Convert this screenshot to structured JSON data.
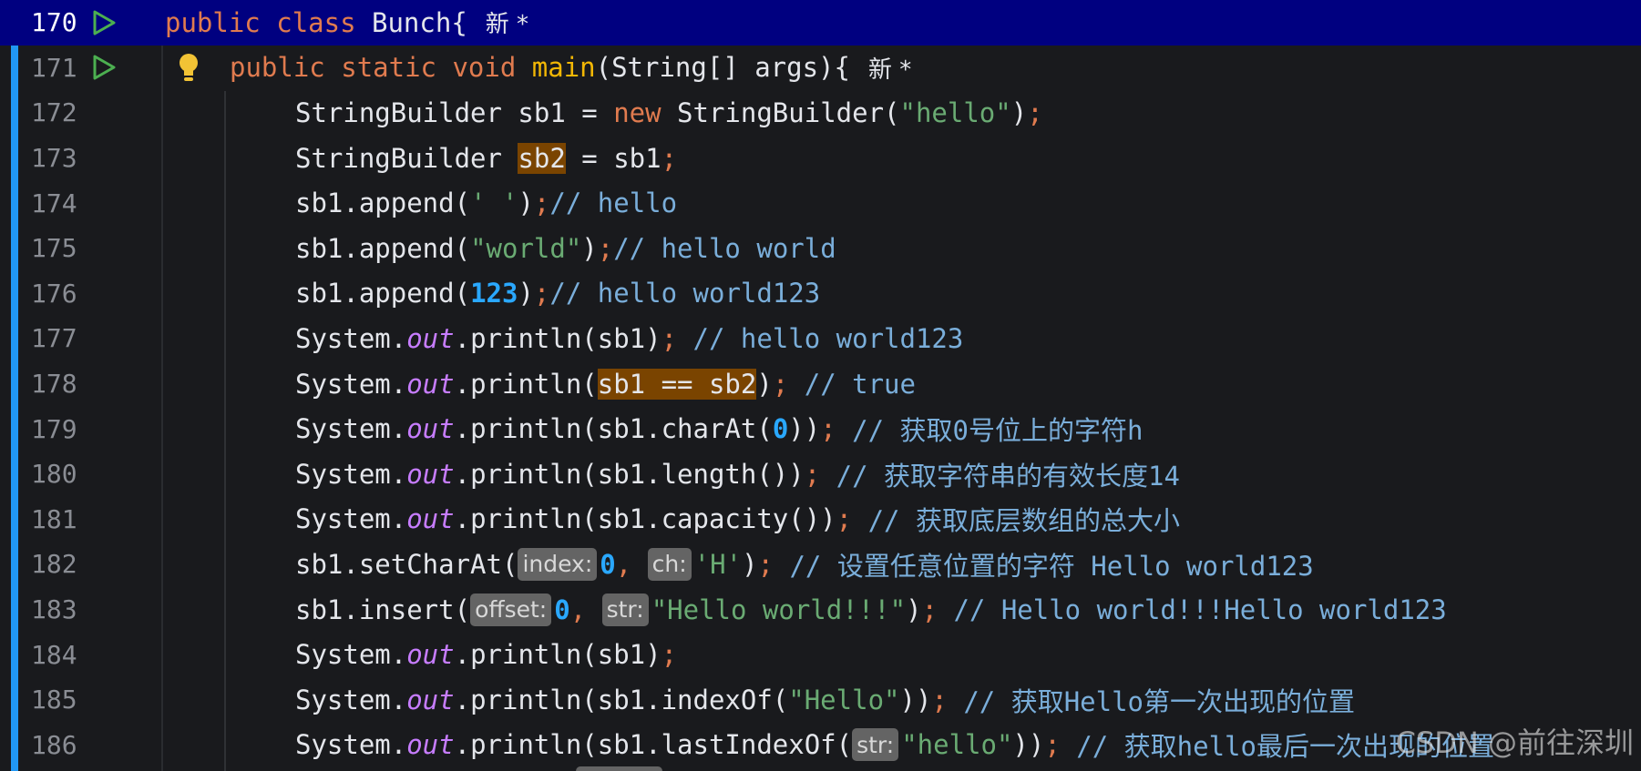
{
  "editor": {
    "language": "Java",
    "watermark": "CSDN @前往深圳",
    "new_mark": "新 *",
    "lines": [
      {
        "number": "170"
      },
      {
        "number": "171"
      },
      {
        "number": "172"
      },
      {
        "number": "173"
      },
      {
        "number": "174"
      },
      {
        "number": "175"
      },
      {
        "number": "176"
      },
      {
        "number": "177"
      },
      {
        "number": "178"
      },
      {
        "number": "179"
      },
      {
        "number": "180"
      },
      {
        "number": "181"
      },
      {
        "number": "182"
      },
      {
        "number": "183"
      },
      {
        "number": "184"
      },
      {
        "number": "185"
      },
      {
        "number": "186"
      }
    ],
    "code": {
      "l170": {
        "kw1": "public",
        "kw2": "class",
        "name": "Bunch{"
      },
      "l171": {
        "kw1": "public",
        "kw2": "static",
        "kw3": "void",
        "fn": "main",
        "rest": "(String[] args){"
      },
      "l172": {
        "a": "StringBuilder sb1 = ",
        "kw": "new",
        "b": " StringBuilder(",
        "str": "\"hello\"",
        "c": ")",
        "semi": ";"
      },
      "l173": {
        "a": "StringBuilder ",
        "hl": "sb2",
        "b": " = sb1",
        "semi": ";"
      },
      "l174": {
        "a": "sb1.append(",
        "str": "' '",
        "b": ")",
        "semi": ";",
        "comment": "// hello"
      },
      "l175": {
        "a": "sb1.append(",
        "str": "\"world\"",
        "b": ")",
        "semi": ";",
        "comment": "// hello world"
      },
      "l176": {
        "a": "sb1.append(",
        "num": "123",
        "b": ")",
        "semi": ";",
        "comment": "// hello world123"
      },
      "l177": {
        "a": "System.",
        "out": "out",
        "b": ".println(sb1)",
        "semi": ";",
        "comment": " // hello world123"
      },
      "l178": {
        "a": "System.",
        "out": "out",
        "b": ".println(",
        "hl": "sb1 == sb2",
        "c": ")",
        "semi": ";",
        "comment": " // true"
      },
      "l179": {
        "a": "System.",
        "out": "out",
        "b": ".println(sb1.charAt(",
        "num": "0",
        "c": "))",
        "semi": ";",
        "comment": " // 获取0号位上的字符h"
      },
      "l180": {
        "a": "System.",
        "out": "out",
        "b": ".println(sb1.length())",
        "semi": ";",
        "comment": " // 获取字符串的有效长度14"
      },
      "l181": {
        "a": "System.",
        "out": "out",
        "b": ".println(sb1.capacity())",
        "semi": ";",
        "comment": " // 获取底层数组的总大小"
      },
      "l182": {
        "a": "sb1.setCharAt(",
        "hint1": "index:",
        "num": "0",
        "sep": ", ",
        "hint2": "ch:",
        "str": "'H'",
        "b": ")",
        "semi": ";",
        "comment": " // 设置任意位置的字符 Hello world123"
      },
      "l183": {
        "a": "sb1.insert(",
        "hint1": "offset:",
        "num": "0",
        "sep": ", ",
        "hint2": "str:",
        "str": "\"Hello world!!!\"",
        "b": ")",
        "semi": ";",
        "comment": " // Hello world!!!Hello world123"
      },
      "l184": {
        "a": "System.",
        "out": "out",
        "b": ".println(sb1)",
        "semi": ";"
      },
      "l185": {
        "a": "System.",
        "out": "out",
        "b": ".println(sb1.indexOf(",
        "str": "\"Hello\"",
        "c": "))",
        "semi": ";",
        "comment": " // 获取Hello第一次出现的位置"
      },
      "l186": {
        "a": "System.",
        "out": "out",
        "b": ".println(sb1.lastIndexOf(",
        "hint": "str:",
        "str": "\"hello\"",
        "c": "))",
        "semi": ";",
        "comment": " // 获取hello最后一次出现的位置"
      }
    }
  }
}
